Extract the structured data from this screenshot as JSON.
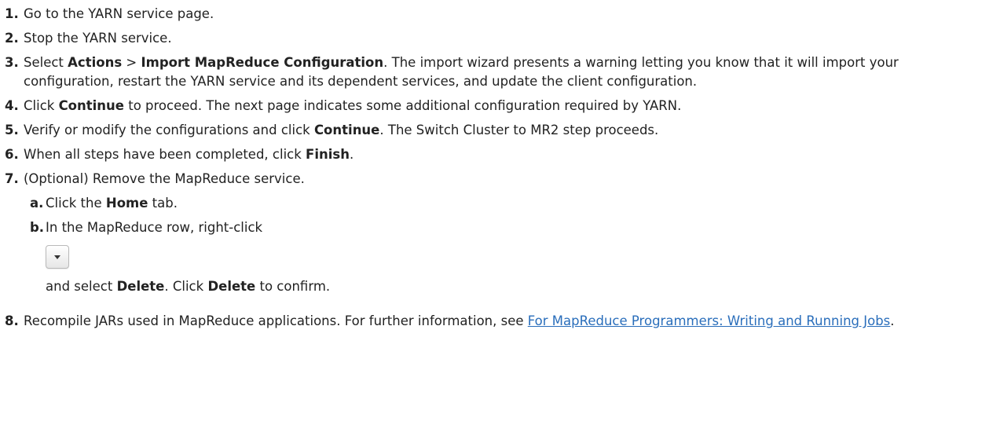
{
  "steps": [
    {
      "num": "1.",
      "text": "Go to the YARN service page."
    },
    {
      "num": "2.",
      "text": "Stop the YARN service."
    },
    {
      "num": "3.",
      "pre": "Select ",
      "actions": "Actions",
      "sep": " > ",
      "import": "Import MapReduce Configuration",
      "post": ". The import wizard presents a warning letting you know that it will import your configuration, restart the YARN service and its dependent services, and update the client configuration."
    },
    {
      "num": "4.",
      "pre": "Click ",
      "bold": "Continue",
      "post": " to proceed. The next page indicates some additional configuration required by YARN."
    },
    {
      "num": "5.",
      "pre": "Verify or modify the configurations and click ",
      "bold": "Continue",
      "post": ". The Switch Cluster to MR2 step proceeds."
    },
    {
      "num": "6.",
      "pre": "When all steps have been completed, click ",
      "bold": "Finish",
      "post": "."
    },
    {
      "num": "7.",
      "text": "(Optional) Remove the MapReduce service.",
      "sub": {
        "a": {
          "num": "a.",
          "pre": "Click the ",
          "bold": "Home",
          "post": " tab."
        },
        "b": {
          "num": "b.",
          "pre": "In the MapReduce row, right-click",
          "after_pre": "and select ",
          "bold1": "Delete",
          "mid": ". Click ",
          "bold2": "Delete",
          "post": " to confirm."
        }
      }
    },
    {
      "num": "8.",
      "pre": "Recompile JARs used in MapReduce applications. For further information, see ",
      "link": "For MapReduce Programmers: Writing and Running Jobs",
      "post": "."
    }
  ],
  "icons": {
    "dropdown": "chevron-down-icon"
  },
  "colors": {
    "link": "#2a6ebb",
    "text": "#222222"
  }
}
